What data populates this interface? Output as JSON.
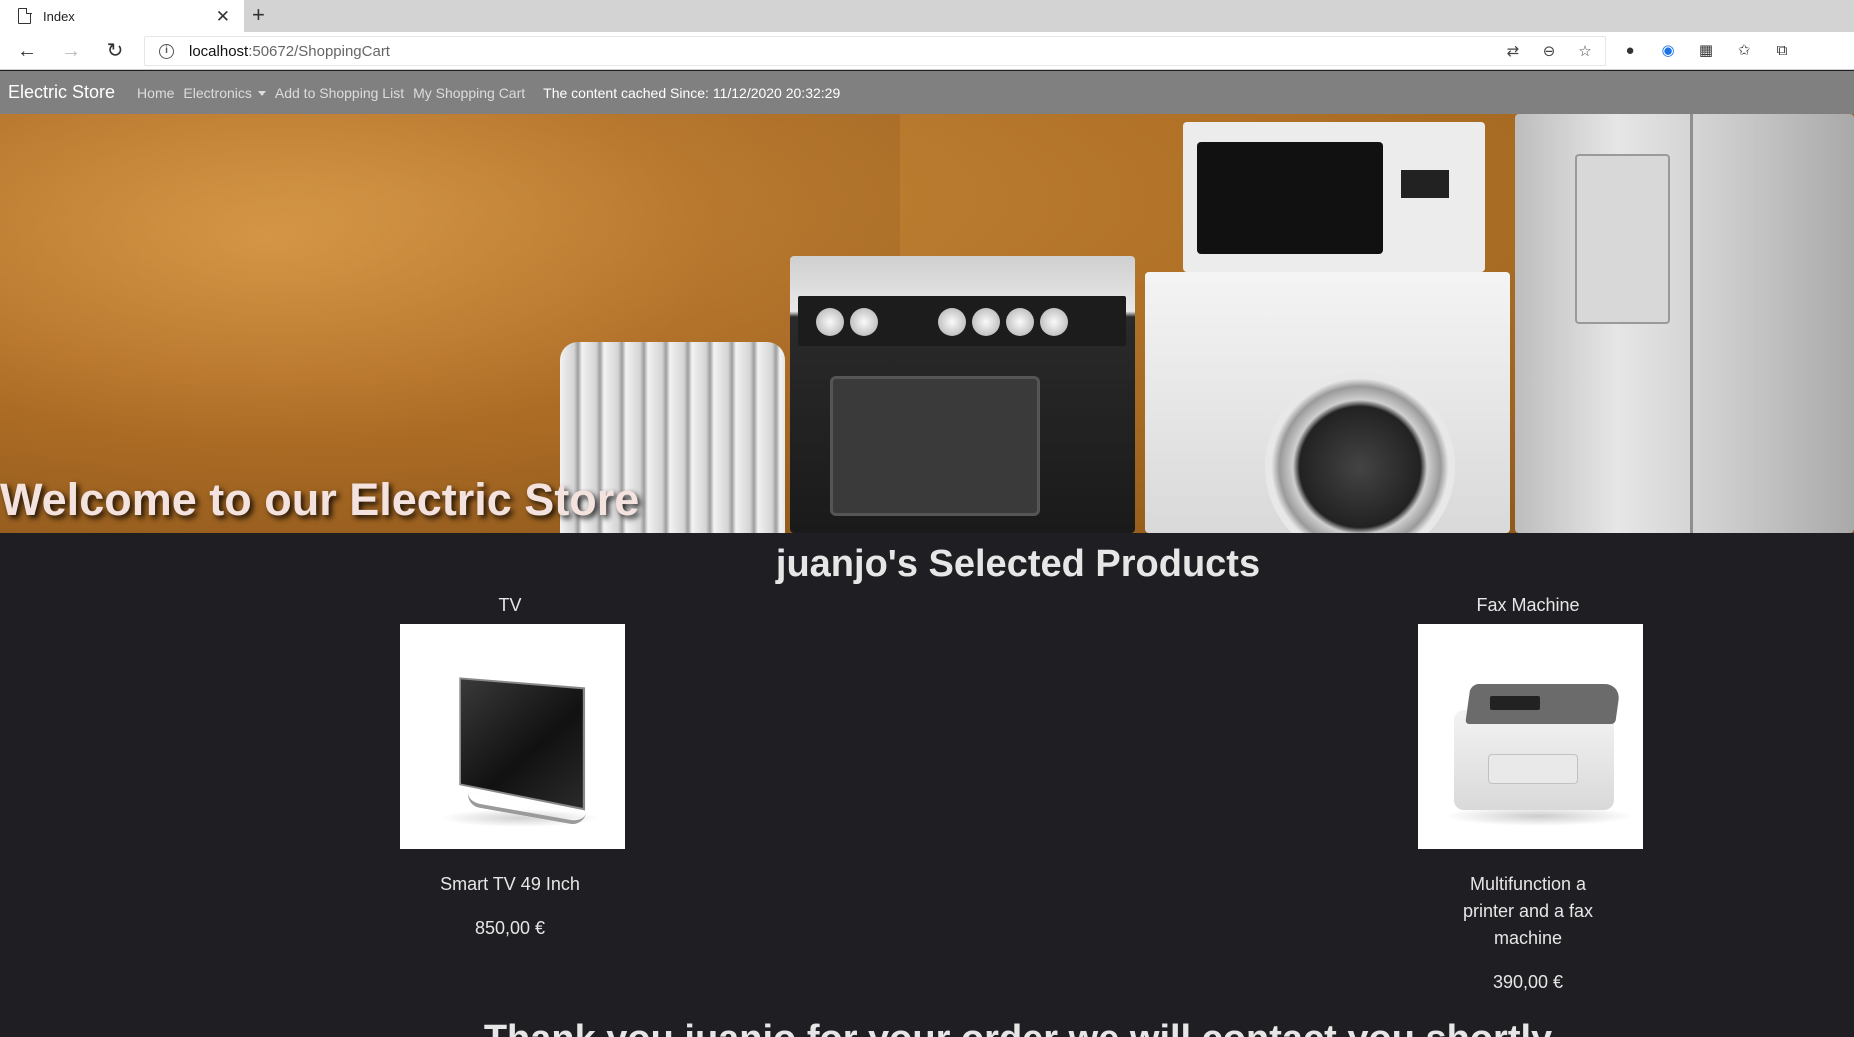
{
  "browser": {
    "tab_title": "Index",
    "tab_close": "✕",
    "new_tab": "+",
    "url_host": "localhost",
    "url_rest": ":50672/ShoppingCart"
  },
  "navbar": {
    "brand": "Electric Store",
    "links": [
      "Home",
      "Electronics",
      "Add to Shopping List",
      "My Shopping Cart"
    ],
    "cache_text": "The content cached Since: 11/12/2020 20:32:29"
  },
  "hero": {
    "title": "Welcome to our Electric Store"
  },
  "main": {
    "section_title": "juanjo's Selected Products",
    "products": [
      {
        "name": "TV",
        "description": "Smart TV 49 Inch",
        "price": "850,00 €"
      },
      {
        "name": "Fax Machine",
        "description": "Multifunction a printer and a fax machine",
        "price": "390,00 €"
      }
    ],
    "thanks": "Thank you juanjo for your order we will contact you shortly"
  }
}
